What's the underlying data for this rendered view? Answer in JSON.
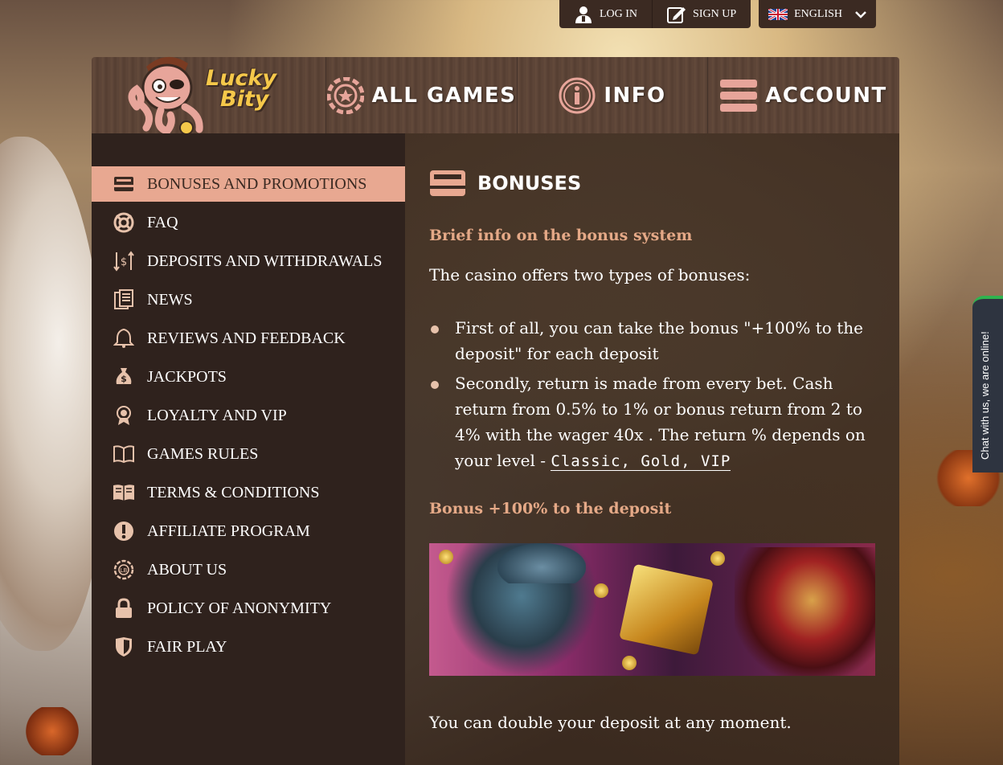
{
  "topbar": {
    "login_label": "LOG IN",
    "signup_label": "SIGN UP",
    "language_label": "ENGLISH"
  },
  "logo": {
    "line1": "Lucky",
    "line2": "Bity"
  },
  "nav": {
    "games_label": "ALL GAMES",
    "info_label": "INFO",
    "account_label": "ACCOUNT"
  },
  "sidebar": {
    "items": [
      {
        "label": "BONUSES AND PROMOTIONS",
        "icon": "card-icon",
        "active": true
      },
      {
        "label": "FAQ",
        "icon": "lifebuoy-icon"
      },
      {
        "label": "DEPOSITS AND WITHDRAWALS",
        "icon": "dollar-transfer-icon"
      },
      {
        "label": "NEWS",
        "icon": "news-icon"
      },
      {
        "label": "REVIEWS AND FEEDBACK",
        "icon": "bell-icon"
      },
      {
        "label": "JACKPOTS",
        "icon": "money-bag-icon"
      },
      {
        "label": "LOYALTY AND VIP",
        "icon": "award-icon"
      },
      {
        "label": "GAMES RULES",
        "icon": "book-icon"
      },
      {
        "label": "TERMS & CONDITIONS",
        "icon": "open-book-icon"
      },
      {
        "label": "AFFILIATE PROGRAM",
        "icon": "exclamation-icon"
      },
      {
        "label": "ABOUT US",
        "icon": "chip-icon"
      },
      {
        "label": "POLICY OF ANONYMITY",
        "icon": "lock-icon"
      },
      {
        "label": "FAIR PLAY",
        "icon": "shield-icon"
      }
    ]
  },
  "content": {
    "title": "BONUSES",
    "section1_heading": "Brief info on the bonus system",
    "intro": "The casino offers two types of bonuses:",
    "bullet1": "First of all, you can take the bonus \"+100% to the deposit\" for each deposit",
    "bullet2_text": "Secondly, return is made from every bet. Cash return from 0.5% to 1% or bonus return from 2 to 4% with the wager 40x . The return % depends on your level - ",
    "bullet2_link": "Classic, Gold, VIP",
    "section2_heading": "Bonus +100% to the deposit",
    "bottom_text": "You can double your deposit at any moment."
  },
  "chat": {
    "label": "Chat with us, we are online!"
  },
  "colors": {
    "accent": "#e8a891",
    "heading_accent": "#e5a987",
    "panel_dark": "#2f221d",
    "header_wood": "#5b4336",
    "chat_green": "#2fb34f"
  }
}
